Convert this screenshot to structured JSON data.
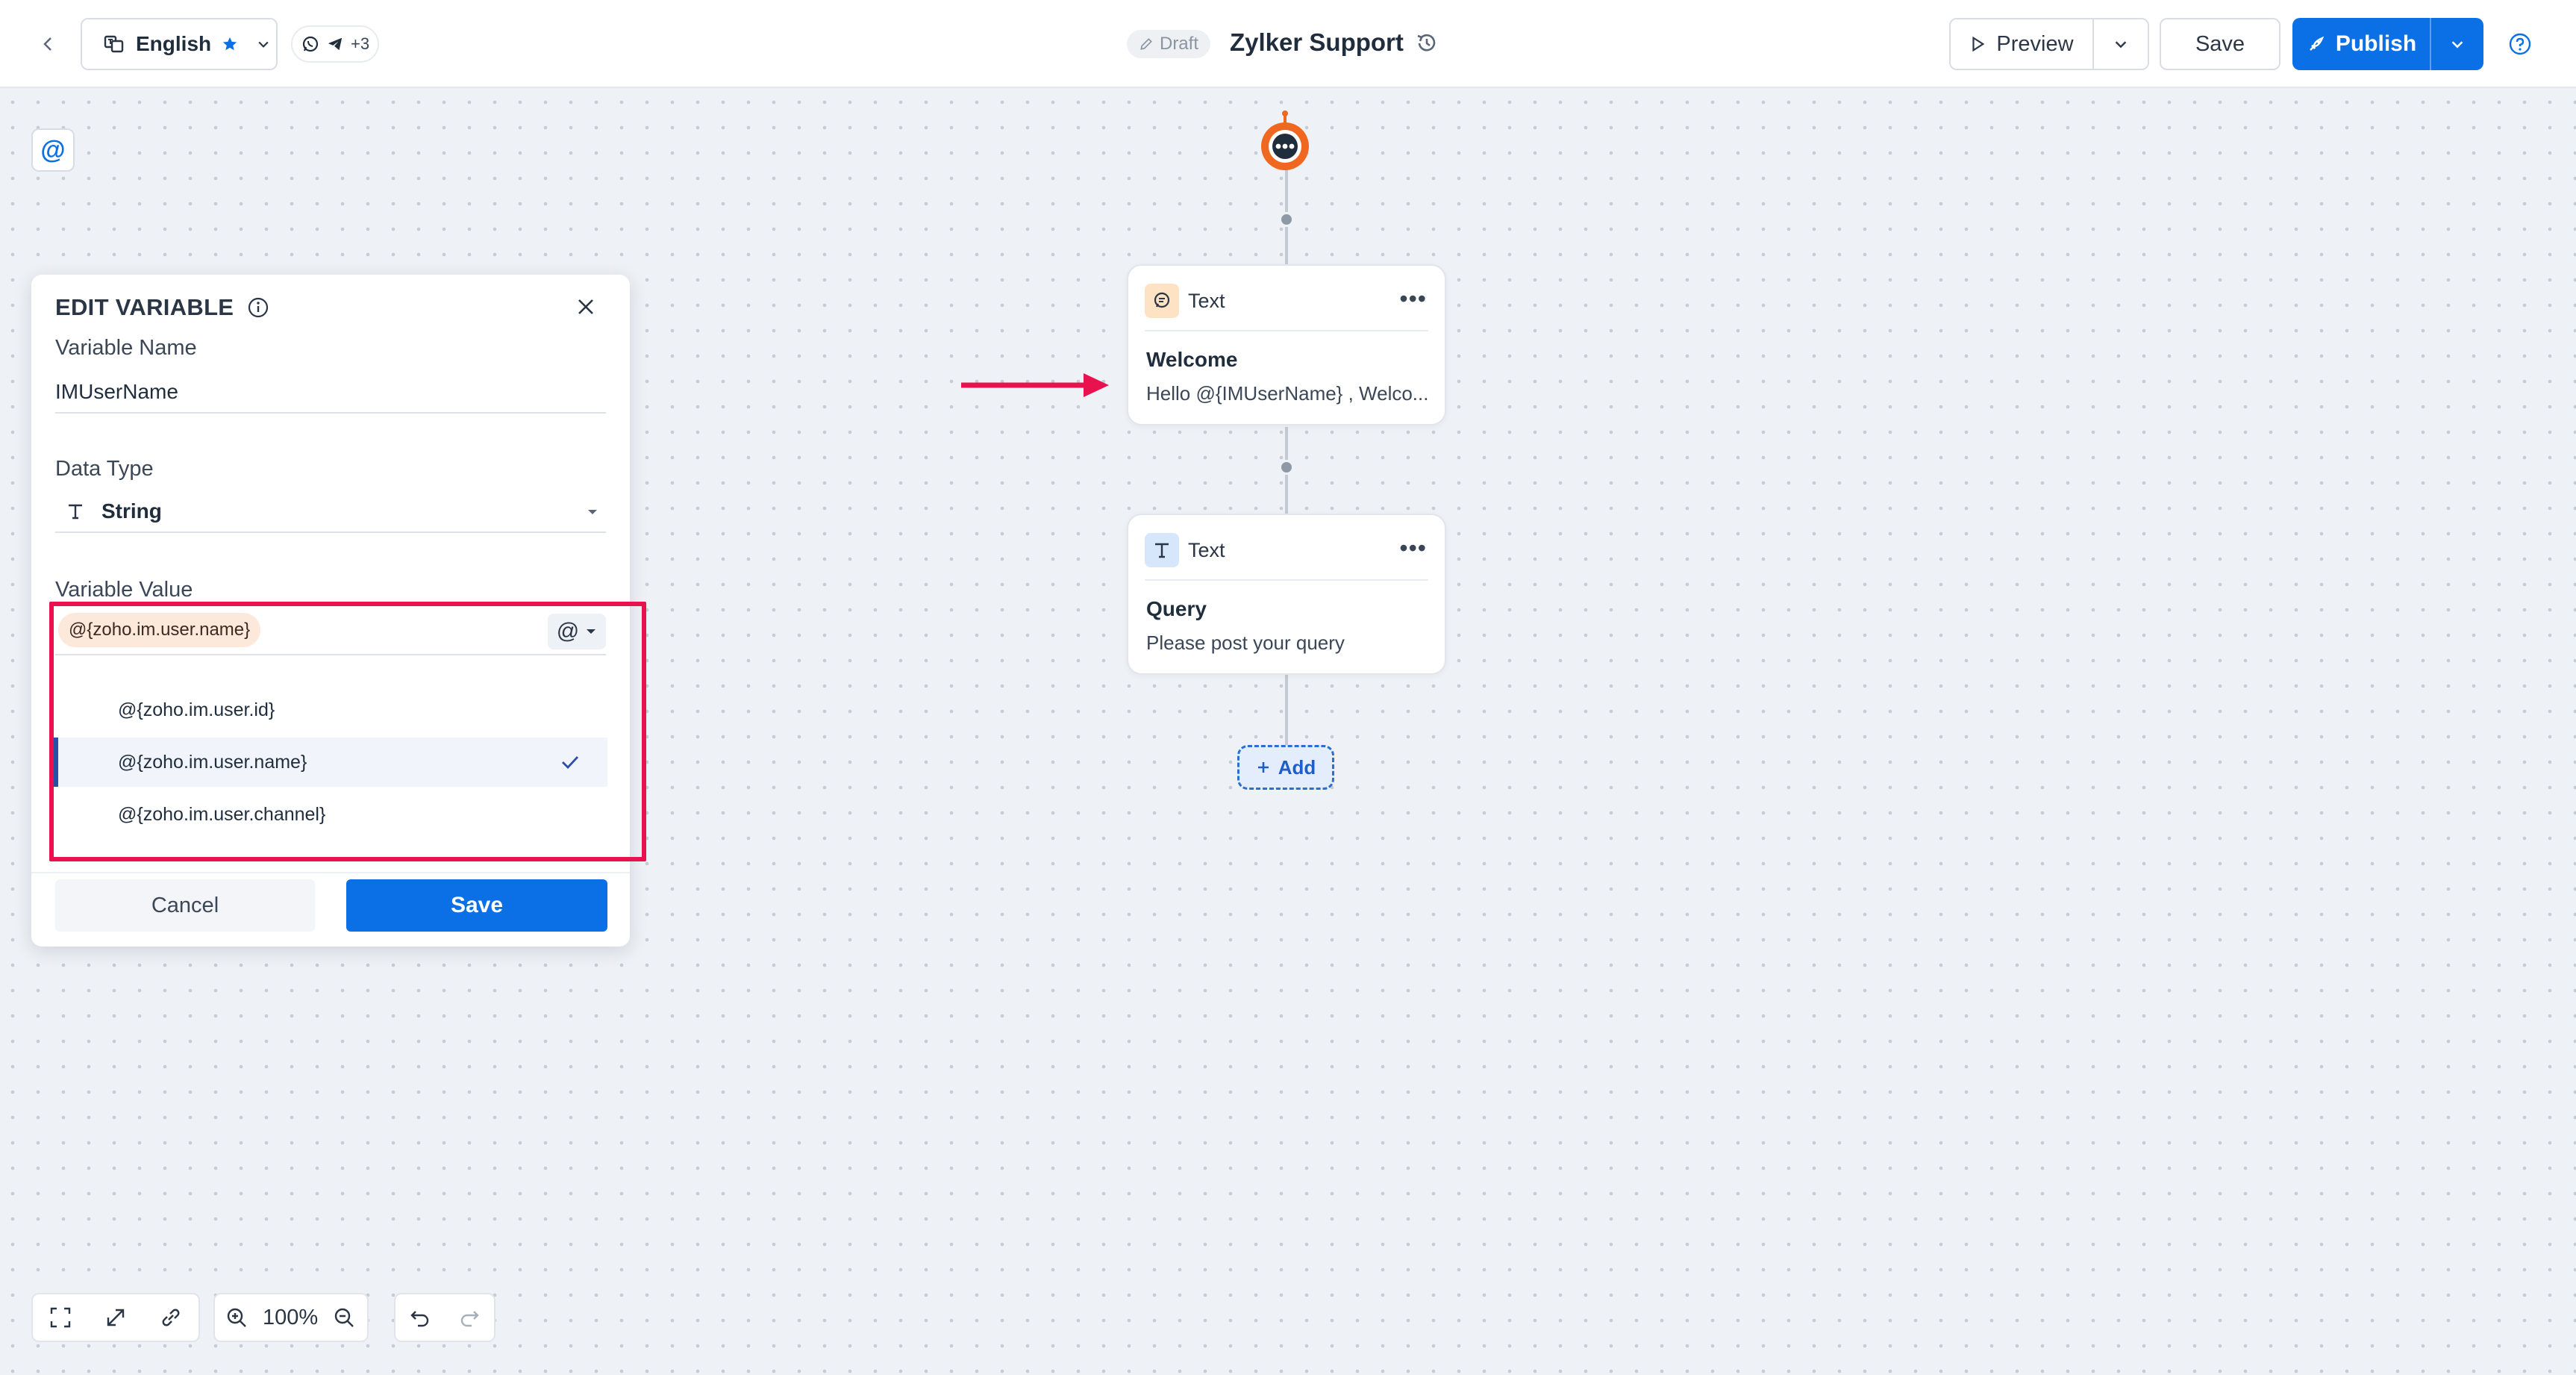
{
  "topbar": {
    "language": "English",
    "channels_more": "+3",
    "draft_label": "Draft",
    "bot_name": "Zylker Support",
    "preview_label": "Preview",
    "save_label": "Save",
    "publish_label": "Publish"
  },
  "panel": {
    "title": "EDIT VARIABLE",
    "variable_name_label": "Variable Name",
    "variable_name_value": "IMUserName",
    "data_type_label": "Data Type",
    "data_type_value": "String",
    "variable_value_label": "Variable Value",
    "variable_value_chip": "@{zoho.im.user.name}",
    "at_symbol": "@",
    "options": [
      {
        "label": "@{zoho.im.user.id}",
        "selected": false
      },
      {
        "label": "@{zoho.im.user.name}",
        "selected": true
      },
      {
        "label": "@{zoho.im.user.channel}",
        "selected": false
      }
    ],
    "cancel_label": "Cancel",
    "save_label": "Save"
  },
  "flow": {
    "cards": [
      {
        "type_label": "Text",
        "title": "Welcome",
        "body": "Hello @{IMUserName} , Welco...",
        "icon": "chat-bubble-icon"
      },
      {
        "type_label": "Text",
        "title": "Query",
        "body": "Please post your query",
        "icon": "text-type-icon"
      }
    ],
    "add_label": "Add"
  },
  "toolbar": {
    "zoom_level": "100%"
  },
  "colors": {
    "primary": "#0b6fe6",
    "highlight": "#e8124f",
    "bot_orange": "#f0681f"
  }
}
